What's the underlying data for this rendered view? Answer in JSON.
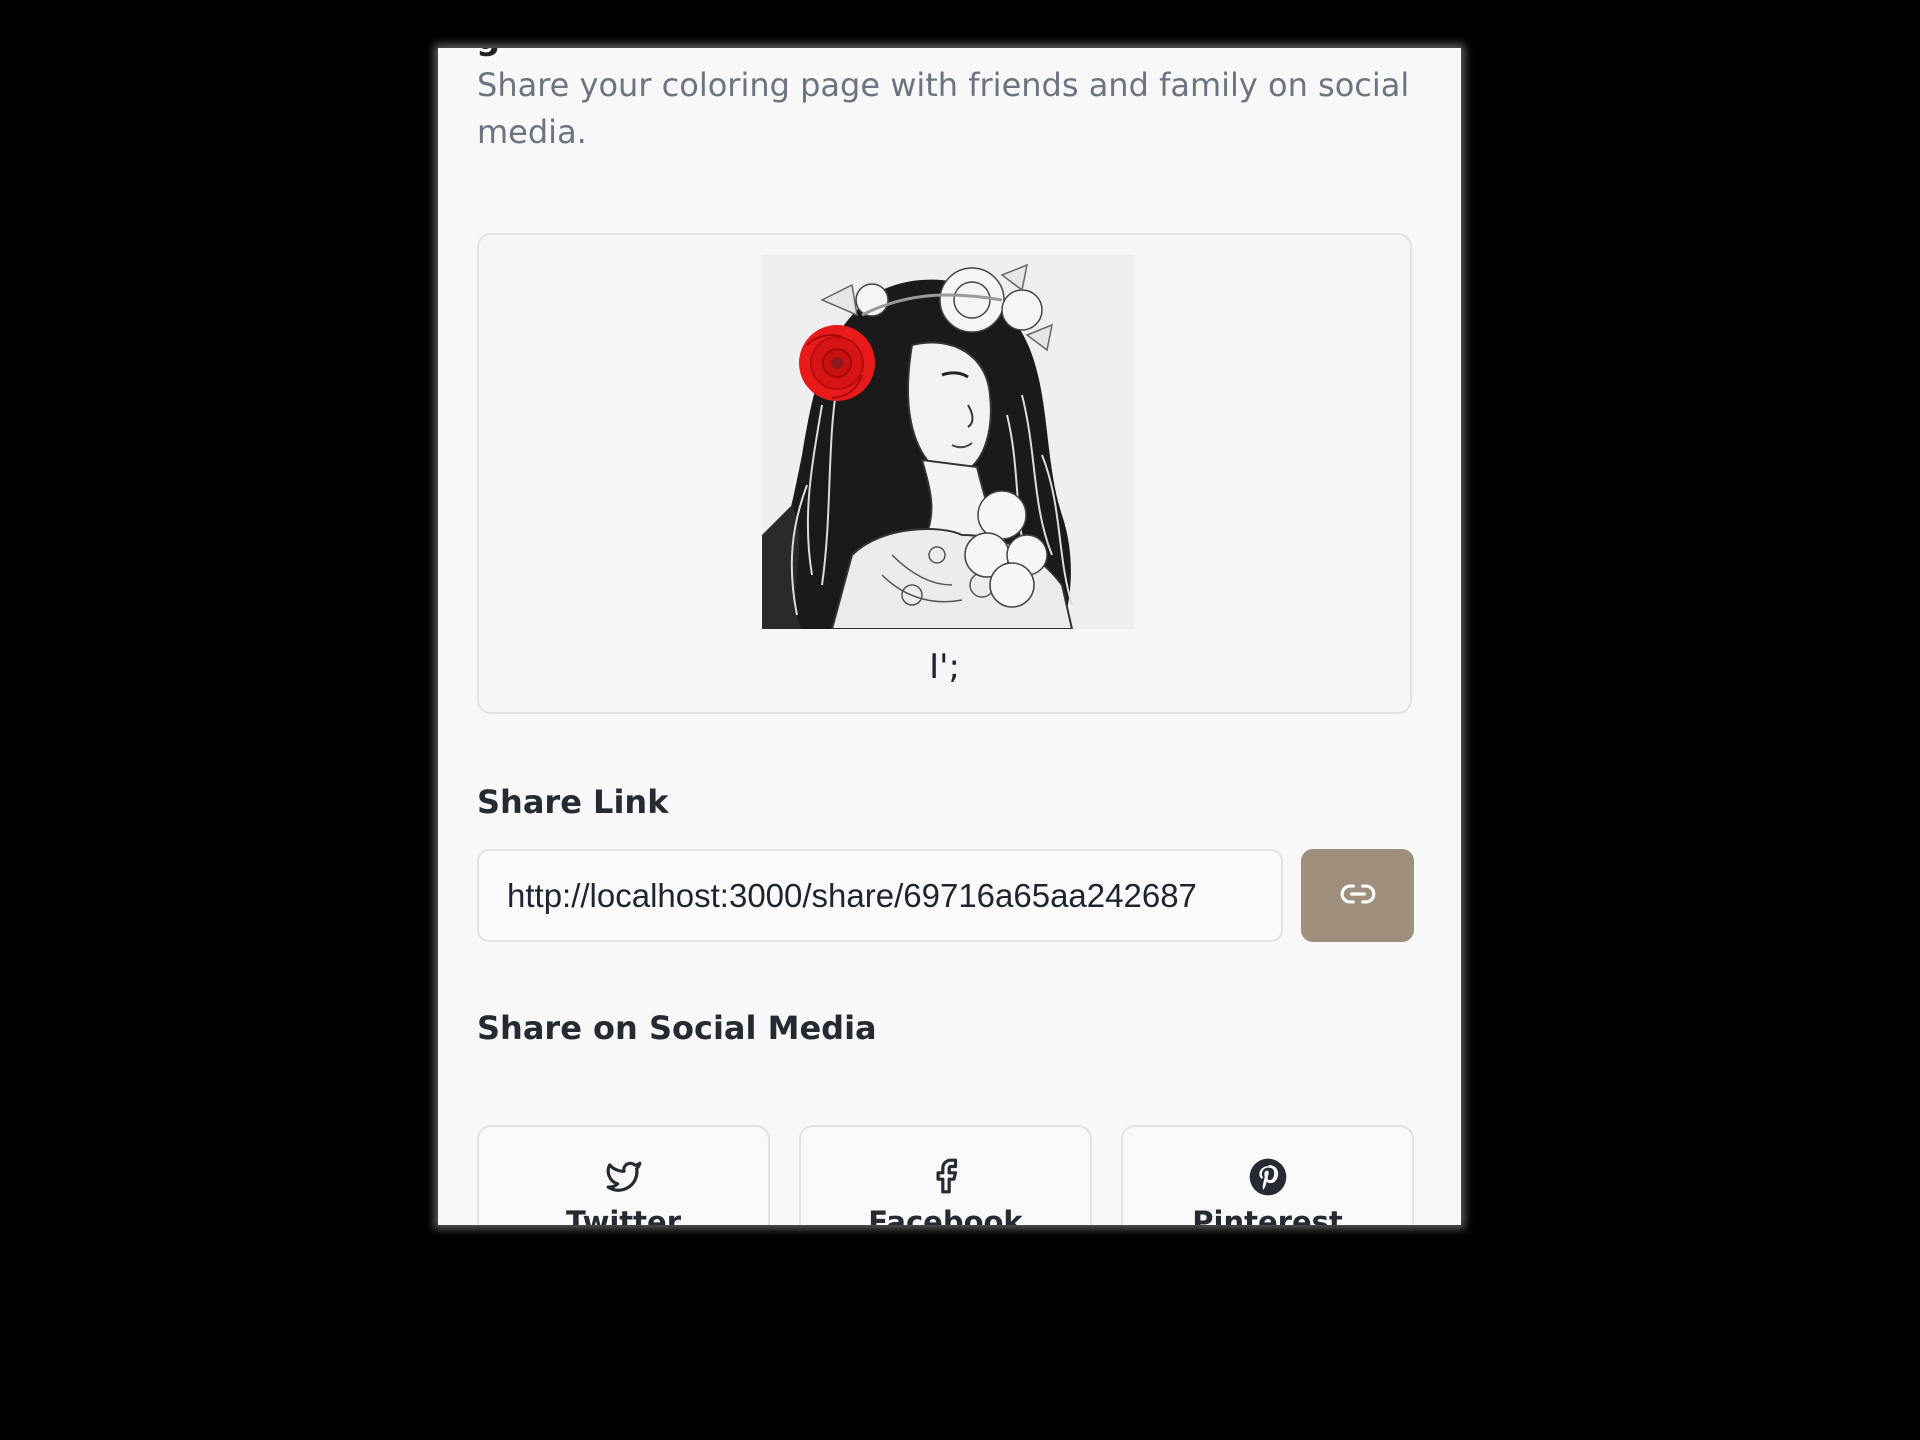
{
  "dialog": {
    "title_partial": "g",
    "description": "Share your coloring page with friends and family on social media.",
    "preview": {
      "caption": "I';",
      "image_icon": "coloring-page-illustration"
    },
    "share_link": {
      "label": "Share Link",
      "url": "http://localhost:3000/share/69716a65aa242687",
      "copy_icon": "link-icon"
    },
    "social": {
      "label": "Share on Social Media",
      "buttons": [
        {
          "label": "Twitter",
          "icon": "twitter-icon"
        },
        {
          "label": "Facebook",
          "icon": "facebook-icon"
        },
        {
          "label": "Pinterest",
          "icon": "pinterest-icon"
        }
      ]
    }
  },
  "colors": {
    "backdrop": "#000000",
    "panel_bg": "#f8f8f8",
    "accent_button": "#a08f7d",
    "description_text": "#6b7480",
    "heading_text": "#262b33",
    "flower_red": "#e81a1a"
  }
}
